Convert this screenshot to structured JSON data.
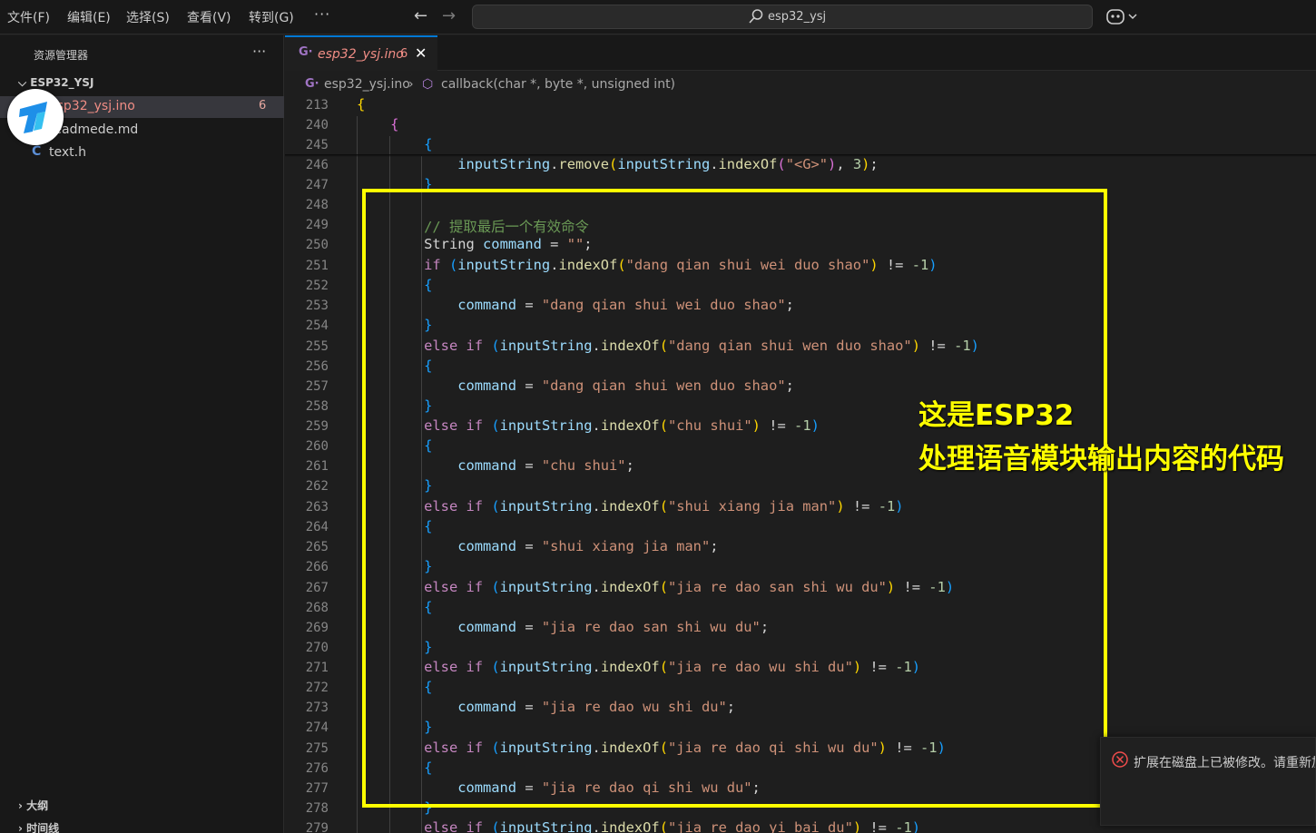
{
  "menu": [
    "文件(F)",
    "编辑(E)",
    "选择(S)",
    "查看(V)",
    "转到(G)"
  ],
  "menu_more": "···",
  "search": {
    "text": "esp32_ysj"
  },
  "sidebar": {
    "title": "资源管理器",
    "more": "···",
    "folder": "ESP32_YSJ",
    "files": [
      {
        "name": "esp32_ysj.ino",
        "badge": "6"
      },
      {
        "name": "readmede.md"
      },
      {
        "name": "text.h",
        "icon": "C"
      }
    ],
    "outline": "大纲",
    "timeline": "时间线"
  },
  "tab": {
    "name": "esp32_ysj.ino",
    "problems": "6"
  },
  "breadcrumb": {
    "file": "esp32_ysj.ino",
    "symbol": "callback(char *, byte *, unsigned int)"
  },
  "code_lines": [
    {
      "n": "213"
    },
    {
      "n": "240"
    },
    {
      "n": "245"
    },
    {
      "n": "246"
    },
    {
      "n": "247"
    },
    {
      "n": "248"
    },
    {
      "n": "249"
    },
    {
      "n": "250"
    },
    {
      "n": "251"
    },
    {
      "n": "252"
    },
    {
      "n": "253"
    },
    {
      "n": "254"
    },
    {
      "n": "255"
    },
    {
      "n": "256"
    },
    {
      "n": "257"
    },
    {
      "n": "258"
    },
    {
      "n": "259"
    },
    {
      "n": "260"
    },
    {
      "n": "261"
    },
    {
      "n": "262"
    },
    {
      "n": "263"
    },
    {
      "n": "264"
    },
    {
      "n": "265"
    },
    {
      "n": "266"
    },
    {
      "n": "267"
    },
    {
      "n": "268"
    },
    {
      "n": "269"
    },
    {
      "n": "270"
    },
    {
      "n": "271"
    },
    {
      "n": "272"
    },
    {
      "n": "273"
    },
    {
      "n": "274"
    },
    {
      "n": "275"
    },
    {
      "n": "276"
    },
    {
      "n": "277"
    },
    {
      "n": "278"
    },
    {
      "n": "279"
    }
  ],
  "code": {
    "comment": "// 提取最后一个有效命令",
    "string_type": "String",
    "command_var": "command",
    "input_var": "inputString",
    "remove_fn": "remove",
    "index_fn": "indexOf",
    "tag_str": "\"<G>\"",
    "three": "3",
    "empty_str": "\"\"",
    "neg_one": "-1",
    "neq": "!=",
    "kw_if": "if",
    "kw_else": "else",
    "commands": [
      "\"dang qian shui wei duo shao\"",
      "\"dang qian shui wen duo shao\"",
      "\"chu shui\"",
      "\"shui xiang jia man\"",
      "\"jia re dao san shi wu du\"",
      "\"jia re dao wu shi du\"",
      "\"jia re dao qi shi wu du\"",
      "\"jia re dao yi bai du\""
    ]
  },
  "annotation": {
    "line1": "这是ESP32",
    "line2": "处理语音模块输出内容的代码",
    "color": "#ffff00"
  },
  "notification": {
    "text": "扩展在磁盘上已被修改。请重新加载窗口。"
  },
  "colors": {
    "accent": "#0078d4",
    "error_tab": "#f08d85",
    "background": "#1e1e1e"
  }
}
